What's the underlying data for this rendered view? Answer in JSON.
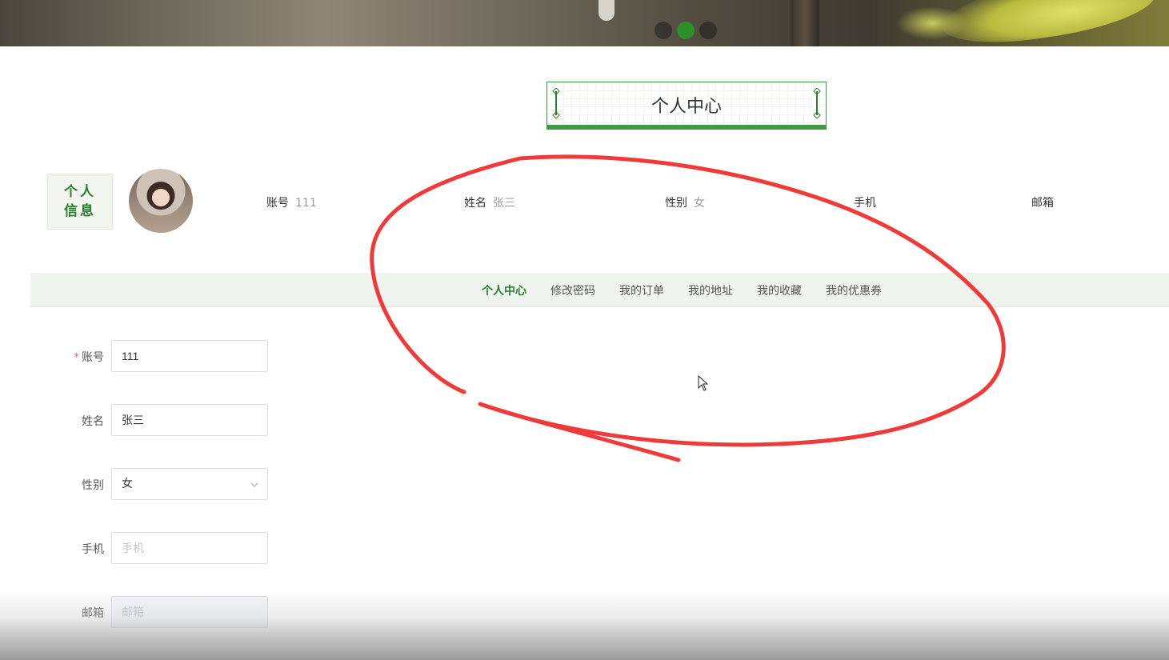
{
  "banner": {
    "slide_count": 3,
    "active_slide": 2
  },
  "page": {
    "title": "个人中心"
  },
  "profile": {
    "label": "个人信息",
    "fields": [
      {
        "label": "账号",
        "value": "111"
      },
      {
        "label": "姓名",
        "value": "张三"
      },
      {
        "label": "性别",
        "value": "女"
      },
      {
        "label": "手机",
        "value": ""
      },
      {
        "label": "邮箱",
        "value": ""
      }
    ]
  },
  "nav": {
    "items": [
      {
        "label": "个人中心",
        "active": true
      },
      {
        "label": "修改密码",
        "active": false
      },
      {
        "label": "我的订单",
        "active": false
      },
      {
        "label": "我的地址",
        "active": false
      },
      {
        "label": "我的收藏",
        "active": false
      },
      {
        "label": "我的优惠券",
        "active": false
      }
    ]
  },
  "form": {
    "account": {
      "label": "账号",
      "required": true,
      "value": "111",
      "placeholder": ""
    },
    "name": {
      "label": "姓名",
      "value": "张三",
      "placeholder": ""
    },
    "gender": {
      "label": "性别",
      "value": "女"
    },
    "phone": {
      "label": "手机",
      "value": "",
      "placeholder": "手机"
    },
    "email": {
      "label": "邮箱",
      "value": "",
      "placeholder": "邮箱"
    }
  },
  "colors": {
    "accent": "#2b7d2e",
    "annotation": "#ef3a3a"
  }
}
